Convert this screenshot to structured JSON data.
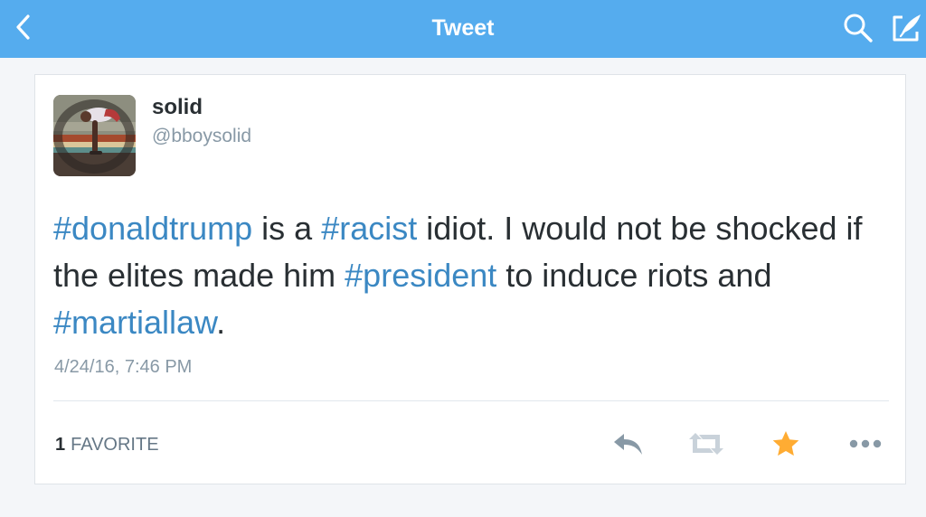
{
  "navbar": {
    "title": "Tweet",
    "back_icon": "chevron-left-icon",
    "search_icon": "search-icon",
    "compose_icon": "compose-icon",
    "background": "#55acee"
  },
  "tweet": {
    "author_name": "solid",
    "author_handle": "@bboysolid",
    "text_segments": [
      {
        "text": "#donaldtrump",
        "hashtag": true
      },
      {
        "text": " is a ",
        "hashtag": false
      },
      {
        "text": "#racist",
        "hashtag": true
      },
      {
        "text": " idiot. I would not be shocked if the elites made him ",
        "hashtag": false
      },
      {
        "text": "#president",
        "hashtag": true
      },
      {
        "text": " to induce riots and ",
        "hashtag": false
      },
      {
        "text": "#martiallaw",
        "hashtag": true
      },
      {
        "text": ".",
        "hashtag": false
      }
    ],
    "timestamp": "4/24/16, 7:46 PM",
    "favorites_count": "1",
    "favorites_label": "FAVORITE",
    "hashtag_color": "#3b88c3",
    "favorite_active_color": "#ffac33"
  },
  "actions": {
    "reply_icon": "reply-icon",
    "retweet_icon": "retweet-icon",
    "favorite_icon": "star-icon",
    "more_icon": "more-icon"
  }
}
